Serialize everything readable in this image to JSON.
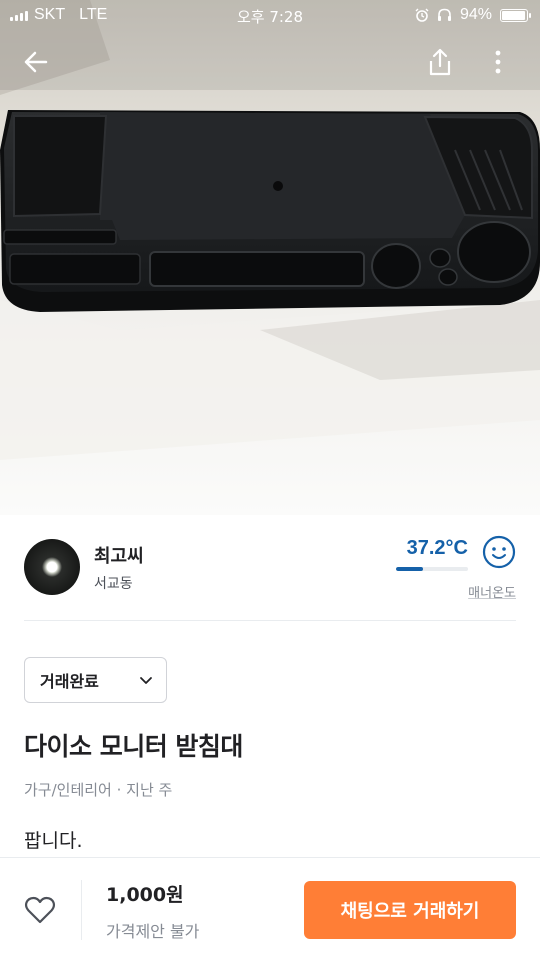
{
  "status_bar": {
    "carrier": "SKT",
    "network": "LTE",
    "time": "오후 7:28",
    "battery_percent": "94%",
    "battery_level": 0.94
  },
  "nav": {
    "back_icon": "arrow-left-icon",
    "share_icon": "share-icon",
    "more_icon": "more-vertical-icon"
  },
  "seller": {
    "nickname": "최고씨",
    "location": "서교동",
    "temperature": "37.2°C",
    "temperature_level": 0.372,
    "manner_label": "매너온도",
    "temp_color": "#1561a9"
  },
  "item": {
    "status": "거래완료",
    "title": "다이소 모니터 받침대",
    "meta": "가구/인테리어 · 지난 주",
    "description": "팝니다."
  },
  "bottom_bar": {
    "price": "1,000원",
    "price_note": "가격제안 불가",
    "chat_button": "채팅으로 거래하기",
    "accent_color": "#ff7e36",
    "like_icon": "heart-outline-icon"
  }
}
